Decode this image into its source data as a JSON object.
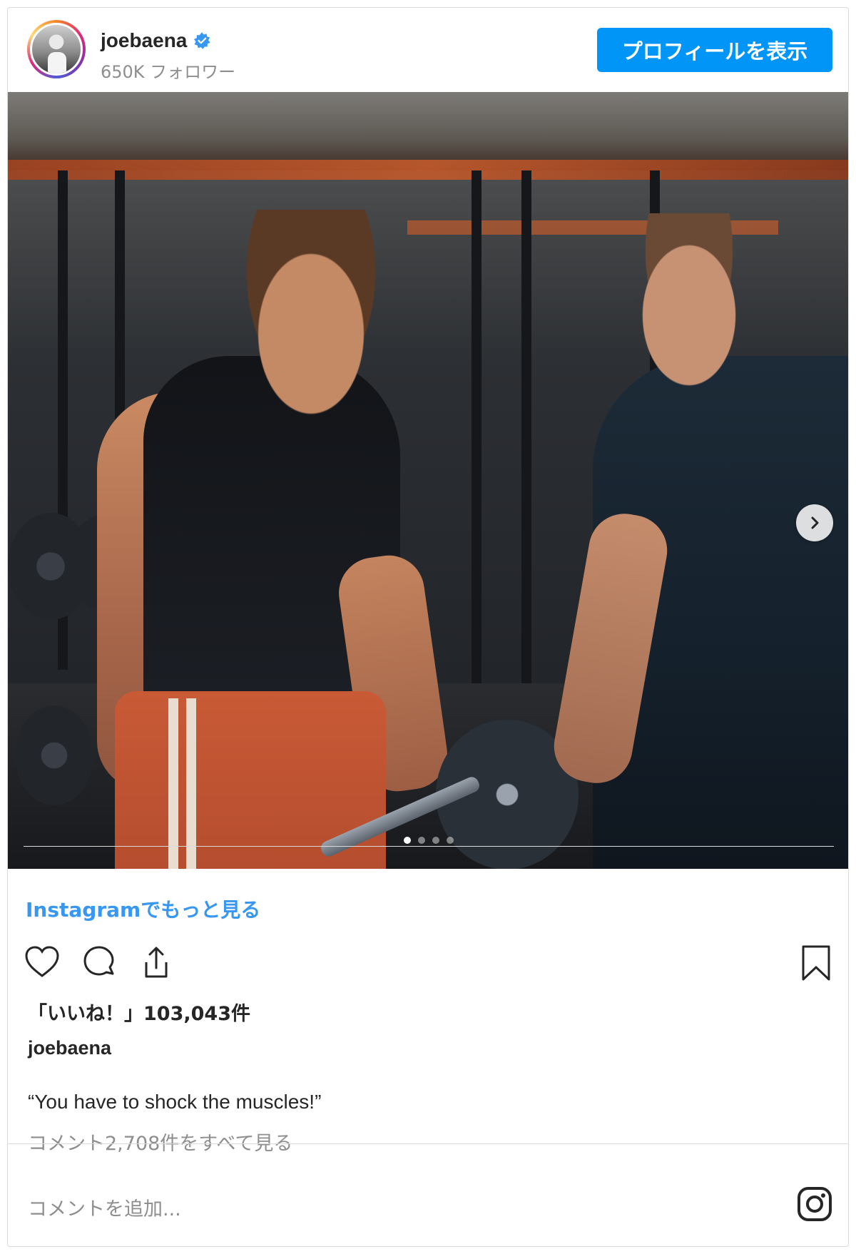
{
  "header": {
    "username": "joebaena",
    "followers": "650K フォロワー",
    "profile_button": "プロフィールを表示",
    "avatar_icon": "profile-avatar",
    "verified_icon": "verified-badge-icon"
  },
  "carousel": {
    "total_slides": 4,
    "current_slide": 1,
    "next_icon": "chevron-right-icon"
  },
  "more_link": "Instagramでもっと見る",
  "actions": {
    "like_icon": "heart-icon",
    "comment_icon": "comment-icon",
    "share_icon": "share-icon",
    "save_icon": "bookmark-icon"
  },
  "likes": "「いいね！」103,043件",
  "caption": {
    "username": "joebaena",
    "text": "“You have to shock the muscles!”"
  },
  "view_comments": "コメント2,708件をすべて見る",
  "comment_input": {
    "placeholder": "コメントを追加..."
  },
  "footer_icon": "instagram-logo-icon",
  "colors": {
    "accent": "#0095f6",
    "link": "#3897f0",
    "muted": "#8e8e8e",
    "text": "#262626"
  }
}
